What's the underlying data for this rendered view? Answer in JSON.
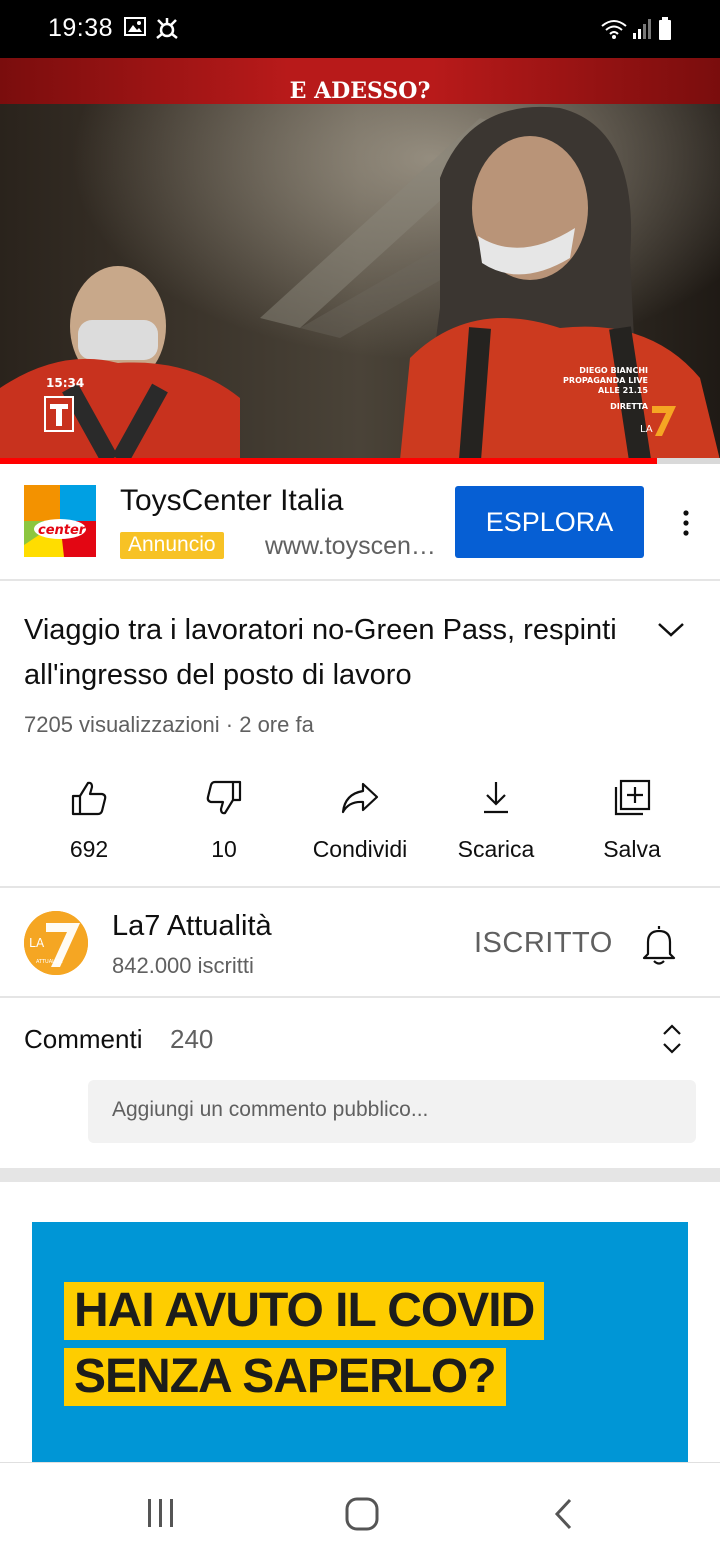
{
  "status_bar": {
    "time": "19:38",
    "icons": [
      "gallery-icon",
      "app-notification-icon",
      "wifi-icon",
      "signal-icon",
      "battery-icon"
    ]
  },
  "video": {
    "banner_text": "E ADESSO?",
    "timestamp_overlay": "15:34",
    "channel_overlay_lines": [
      "DIEGO BIANCHI",
      "PROPAGANDA LIVE",
      "ALLE 21.15",
      "DIRETTA"
    ],
    "progress": 0.913
  },
  "ad": {
    "title": "ToysCenter Italia",
    "badge": "Annuncio",
    "url": "www.toyscenter.it",
    "cta_label": "ESPLORA"
  },
  "video_info": {
    "title": "Viaggio tra i lavoratori no-Green Pass, respinti all'ingresso del posto di lavoro",
    "meta": "7205 visualizzazioni · 2 ore fa"
  },
  "actions": [
    {
      "icon": "like-icon",
      "label": "692"
    },
    {
      "icon": "dislike-icon",
      "label": "10"
    },
    {
      "icon": "share-icon",
      "label": "Condividi"
    },
    {
      "icon": "download-icon",
      "label": "Scarica"
    },
    {
      "icon": "save-playlist-icon",
      "label": "Salva"
    }
  ],
  "channel": {
    "name": "La7 Attualità",
    "subscribers": "842.000 iscritti",
    "subscribe_state": "ISCRITTO",
    "avatar_text": "LA",
    "avatar_sub": "ATTUALITÀ"
  },
  "comments": {
    "label": "Commenti",
    "count": "240",
    "placeholder": "Aggiungi un commento pubblico..."
  },
  "promo": {
    "line1": "HAI AVUTO IL COVID",
    "line2": "SENZA SAPERLO?"
  },
  "colors": {
    "accent_blue": "#065fd4",
    "progress_red": "#ff0000",
    "badge_yellow": "#f7c225",
    "promo_blue": "#0096d6",
    "promo_yellow": "#fecd00"
  }
}
